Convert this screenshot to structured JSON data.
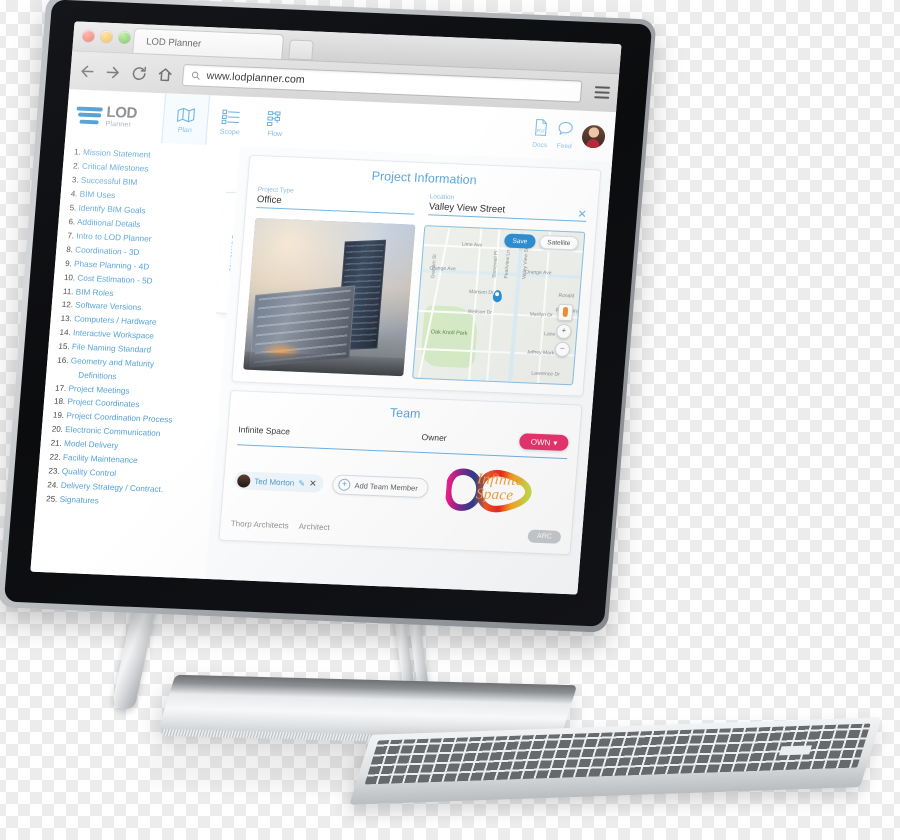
{
  "browser": {
    "tab_title": "LOD Planner",
    "url": "www.lodplanner.com",
    "icons": {
      "back": "back-arrow-icon",
      "forward": "forward-arrow-icon",
      "reload": "reload-icon",
      "home": "home-icon",
      "search": "search-icon",
      "menu": "hamburger-menu-icon"
    },
    "window_controls": [
      "close",
      "minimize",
      "maximize"
    ]
  },
  "app": {
    "brand": {
      "name": "LOD",
      "sub": "Planner"
    },
    "nav_tabs": [
      {
        "label": "Plan",
        "icon": "map-fold-icon",
        "active": true
      },
      {
        "label": "Scope",
        "icon": "checklist-icon",
        "active": false
      },
      {
        "label": "Flow",
        "icon": "flowchart-icon",
        "active": false
      }
    ],
    "header_right": [
      {
        "label": "Docs",
        "icon": "pdf-document-icon"
      },
      {
        "label": "Feed",
        "icon": "speech-bubble-icon"
      }
    ],
    "avatar_name": "user-avatar"
  },
  "sidebar": {
    "tab_label": "Contents",
    "items": [
      {
        "num": "1.",
        "label": "Mission Statement"
      },
      {
        "num": "2.",
        "label": "Critical Milestones"
      },
      {
        "num": "3.",
        "label": "Successful BIM"
      },
      {
        "num": "4.",
        "label": "BIM Uses"
      },
      {
        "num": "5.",
        "label": "Identify BIM Goals"
      },
      {
        "num": "6.",
        "label": "Additional Details"
      },
      {
        "num": "7.",
        "label": "Intro to LOD Planner"
      },
      {
        "num": "8.",
        "label": "Coordination - 3D"
      },
      {
        "num": "9.",
        "label": "Phase Planning - 4D"
      },
      {
        "num": "10.",
        "label": "Cost Estimation - 5D"
      },
      {
        "num": "11.",
        "label": "BIM Roles"
      },
      {
        "num": "12.",
        "label": "Software Versions"
      },
      {
        "num": "13.",
        "label": "Computers / Hardware"
      },
      {
        "num": "14.",
        "label": "Interactive Workspace"
      },
      {
        "num": "15.",
        "label": "File Naming Standard"
      },
      {
        "num": "16.",
        "label": "Geometry and Maturity"
      },
      {
        "num": "",
        "label": "Definitions",
        "sub": true
      },
      {
        "num": "17.",
        "label": "Project Meetings"
      },
      {
        "num": "18.",
        "label": "Project Coordinates"
      },
      {
        "num": "19.",
        "label": "Project Coordination Process"
      },
      {
        "num": "20.",
        "label": "Electronic Communication"
      },
      {
        "num": "21.",
        "label": "Model Delivery"
      },
      {
        "num": "22.",
        "label": "Facility Maintenance"
      },
      {
        "num": "23.",
        "label": "Quality Control"
      },
      {
        "num": "24.",
        "label": "Delivery Strategy / Contract."
      },
      {
        "num": "25.",
        "label": "Signatures"
      }
    ]
  },
  "project_information": {
    "title": "Project Information",
    "fields": [
      {
        "label": "Project Type",
        "value": "Office",
        "placeholder": "Project Type"
      },
      {
        "label": "Location",
        "value": "Valley View Street",
        "placeholder": "Location"
      }
    ],
    "clear_icon": "✕",
    "photo_alt": "project-building-render"
  },
  "map": {
    "buttons": [
      {
        "label": "Save",
        "primary": true
      },
      {
        "label": "Satellite",
        "primary": false
      }
    ],
    "controls": {
      "pegman": "street-view-pegman-icon",
      "zoom_in": "+",
      "zoom_out": "−"
    },
    "park_label": "Oak Knoll\nPark",
    "streets": [
      "Lime Ave",
      "Orange Ave",
      "Orange Ave",
      "Manson Dr",
      "Wellson Dr",
      "Stonewall Pl",
      "Pearlview Ln",
      "Valley View St",
      "Marilyn Dr",
      "Ronald",
      "Rosemary",
      "Jeffrey Mark St",
      "Lawrence Dr",
      "Graham St",
      "Lane"
    ],
    "pin_label": "project-location-pin"
  },
  "team": {
    "title": "Team",
    "company": "Infinite Space",
    "role": "Owner",
    "badge": "OWN",
    "badge_caret": "▾",
    "divider_color": "#6fb3e2",
    "members": [
      {
        "name": "Ted Morton",
        "edit_icon": "edit-user-icon",
        "remove_icon": "✕"
      }
    ],
    "add_button": "Add Team Member",
    "logo_text_line1": "Infinite",
    "logo_text_line2": "Space",
    "next_row": {
      "company": "Thorp Architects",
      "role": "Architect",
      "badge": "ARC"
    }
  },
  "colors": {
    "accent_blue": "#59a8dc",
    "brand_blue": "#1f7fc4",
    "badge_pink": "#e8346f",
    "pegman_orange": "#f09235",
    "logo_orange": "#f0a13c"
  }
}
